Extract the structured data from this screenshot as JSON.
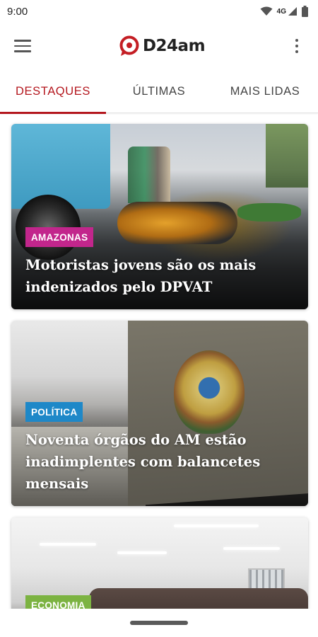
{
  "status_bar": {
    "time": "9:00",
    "network": "4G",
    "icons": [
      "wifi-icon",
      "signal-icon",
      "battery-icon"
    ]
  },
  "app_bar": {
    "logo_text": "D24am",
    "menu_icon": "hamburger-menu-icon",
    "more_icon": "more-vert-icon"
  },
  "tabs": [
    {
      "label": "DESTAQUES",
      "active": true
    },
    {
      "label": "ÚLTIMAS",
      "active": false
    },
    {
      "label": "MAIS LIDAS",
      "active": false
    }
  ],
  "articles": [
    {
      "category": "AMAZONAS",
      "category_color": "#c2268c",
      "headline": "Motoristas jovens são os mais indenizados pelo DPVAT"
    },
    {
      "category": "POLÍTICA",
      "category_color": "#1e88c8",
      "headline": "Noventa órgãos do AM estão inadimplentes com balancetes mensais"
    },
    {
      "category": "ECONOMIA",
      "category_color": "#7cb342",
      "headline": ""
    }
  ],
  "colors": {
    "accent": "#b4171e",
    "tab_text": "#444444"
  }
}
